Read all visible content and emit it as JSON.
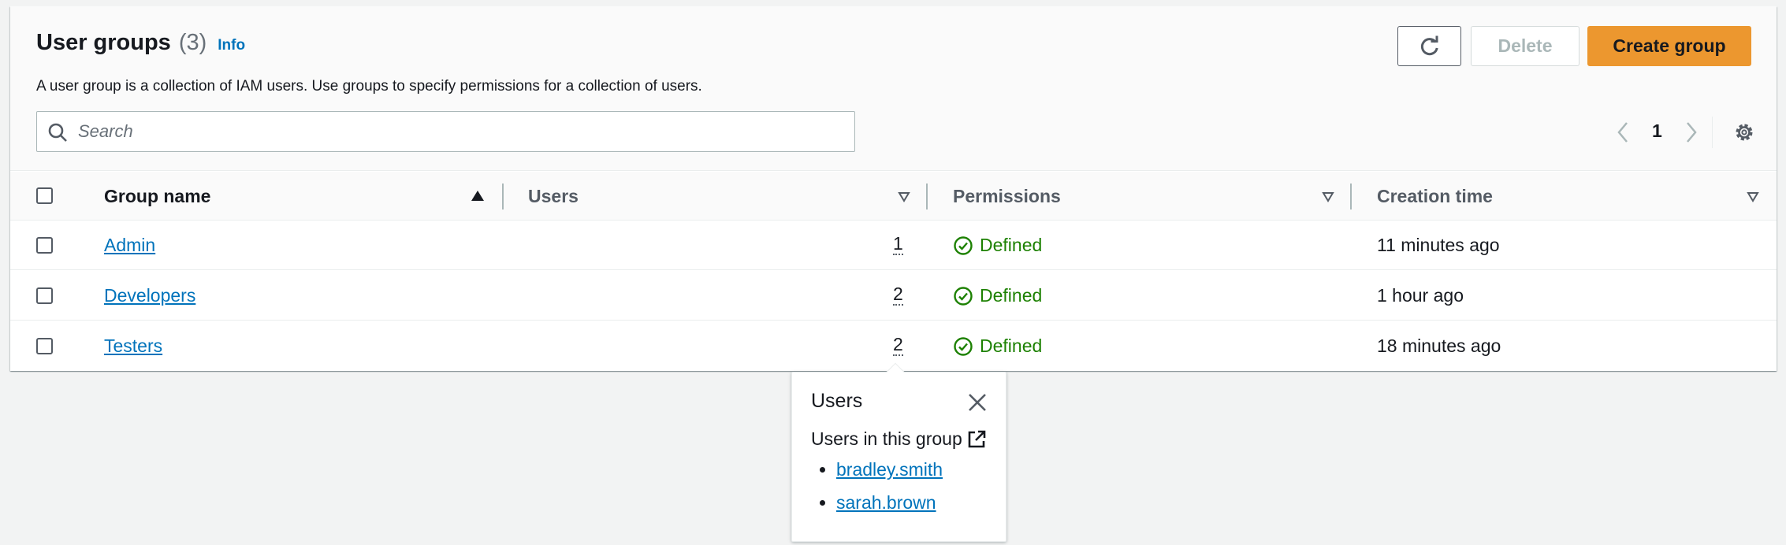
{
  "header": {
    "title": "User groups",
    "count": "(3)",
    "info_label": "Info",
    "description": "A user group is a collection of IAM users. Use groups to specify permissions for a collection of users."
  },
  "actions": {
    "delete_label": "Delete",
    "create_label": "Create group"
  },
  "search": {
    "placeholder": "Search",
    "value": ""
  },
  "pagination": {
    "current_page": "1"
  },
  "table": {
    "columns": [
      "Group name",
      "Users",
      "Permissions",
      "Creation time"
    ],
    "rows": [
      {
        "name": "Admin",
        "users": "1",
        "permissions": "Defined",
        "created": "11 minutes ago"
      },
      {
        "name": "Developers",
        "users": "2",
        "permissions": "Defined",
        "created": "1 hour ago"
      },
      {
        "name": "Testers",
        "users": "2",
        "permissions": "Defined",
        "created": "18 minutes ago"
      }
    ]
  },
  "popover": {
    "title": "Users",
    "subtitle": "Users in this group",
    "users": [
      "bradley.smith",
      "sarah.brown"
    ]
  },
  "colors": {
    "accent": "#ec972f",
    "link": "#0073bb",
    "success": "#1d8102"
  },
  "icons": {
    "refresh": "refresh-icon",
    "search": "search-icon",
    "prev": "chevron-left-icon",
    "next": "chevron-right-icon",
    "settings": "gear-icon",
    "sort_asc": "sort-ascending-icon",
    "sort": "sort-caret-icon",
    "status": "check-circle-icon",
    "close": "close-icon",
    "external": "external-link-icon"
  }
}
